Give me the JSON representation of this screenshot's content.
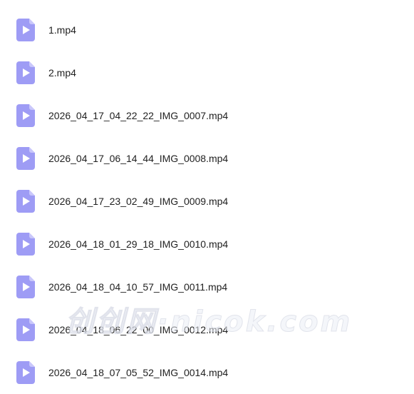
{
  "files": [
    {
      "name": "1.mp4",
      "icon": "video-file-icon"
    },
    {
      "name": "2.mp4",
      "icon": "video-file-icon"
    },
    {
      "name": "2026_04_17_04_22_22_IMG_0007.mp4",
      "icon": "video-file-icon"
    },
    {
      "name": "2026_04_17_06_14_44_IMG_0008.mp4",
      "icon": "video-file-icon"
    },
    {
      "name": "2026_04_17_23_02_49_IMG_0009.mp4",
      "icon": "video-file-icon"
    },
    {
      "name": "2026_04_18_01_29_18_IMG_0010.mp4",
      "icon": "video-file-icon"
    },
    {
      "name": "2026_04_18_04_10_57_IMG_0011.mp4",
      "icon": "video-file-icon"
    },
    {
      "name": "2026_04_18_06_22_00_IMG_0012.mp4",
      "icon": "video-file-icon"
    },
    {
      "name": "2026_04_18_07_05_52_IMG_0014.mp4",
      "icon": "video-file-icon"
    }
  ],
  "watermark": "创创网·nicok.com",
  "colors": {
    "icon_body": "#9e9cf5",
    "icon_fold": "#c9c7fb",
    "icon_play": "#ffffff",
    "text": "#1f1f1f"
  }
}
